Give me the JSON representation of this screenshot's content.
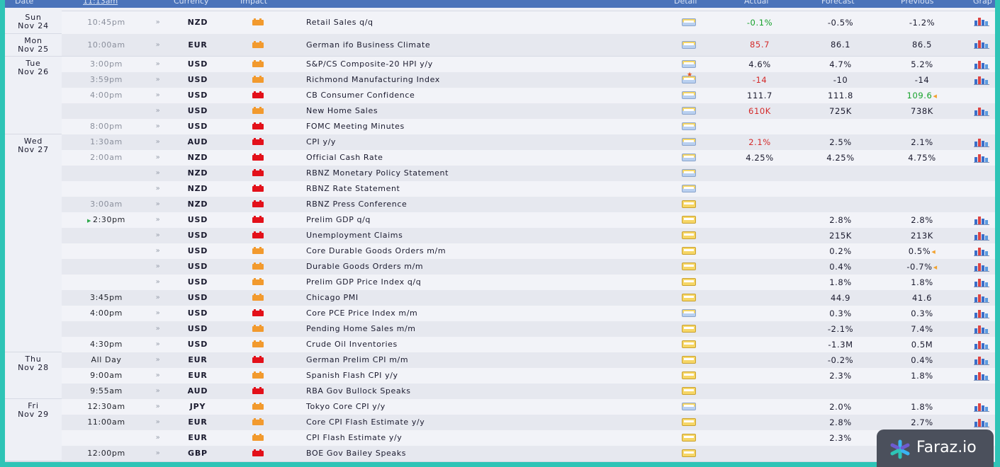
{
  "header": {
    "date": "Date",
    "time": "11:13am",
    "currency": "Currency",
    "impact": "Impact",
    "detail": "Detail",
    "actual": "Actual",
    "forecast": "Forecast",
    "previous": "Previous",
    "graph": "Grap"
  },
  "colors": {
    "high_impact": "#e3101a",
    "medium_impact": "#f29a2e",
    "negative": "#d42a2a",
    "positive": "#16a12b",
    "frame": "#2ec4b6"
  },
  "days": [
    {
      "label": "Sun",
      "date": "Nov 24"
    },
    {
      "label": "Mon",
      "date": "Nov 25"
    },
    {
      "label": "Tue",
      "date": "Nov 26"
    },
    {
      "label": "Wed",
      "date": "Nov 27"
    },
    {
      "label": "Thu",
      "date": "Nov 28"
    },
    {
      "label": "Fri",
      "date": "Nov 29"
    }
  ],
  "events": [
    {
      "time": "10:45pm",
      "currency": "NZD",
      "impact": "medium",
      "event": "Retail Sales q/q",
      "actual": "-0.1%",
      "actual_tone": "pos",
      "forecast": "-0.5%",
      "previous": "-1.2%",
      "graph": true,
      "detail": "blue"
    },
    {
      "time": "10:00am",
      "currency": "EUR",
      "impact": "medium",
      "event": "German ifo Business Climate",
      "actual": "85.7",
      "actual_tone": "neg",
      "forecast": "86.1",
      "previous": "86.5",
      "graph": true,
      "detail": "blue"
    },
    {
      "time": "3:00pm",
      "currency": "USD",
      "impact": "medium",
      "event": "S&P/CS Composite-20 HPI y/y",
      "actual": "4.6%",
      "actual_tone": "",
      "forecast": "4.7%",
      "previous": "5.2%",
      "graph": true,
      "detail": "blue"
    },
    {
      "time": "3:59pm",
      "currency": "USD",
      "impact": "medium",
      "event": "Richmond Manufacturing Index",
      "actual": "-14",
      "actual_tone": "neg",
      "forecast": "-10",
      "previous": "-14",
      "graph": true,
      "detail": "star"
    },
    {
      "time": "4:00pm",
      "currency": "USD",
      "impact": "high",
      "event": "CB Consumer Confidence",
      "actual": "111.7",
      "actual_tone": "",
      "forecast": "111.8",
      "previous": "109.6",
      "previous_tone": "pos",
      "previous_arrow": "orange",
      "graph": false,
      "detail": "blue"
    },
    {
      "time": "",
      "currency": "USD",
      "impact": "medium",
      "event": "New Home Sales",
      "actual": "610K",
      "actual_tone": "neg",
      "forecast": "725K",
      "previous": "738K",
      "graph": true,
      "detail": "blue"
    },
    {
      "time": "8:00pm",
      "currency": "USD",
      "impact": "high",
      "event": "FOMC Meeting Minutes",
      "actual": "",
      "forecast": "",
      "previous": "",
      "graph": false,
      "detail": "blue"
    },
    {
      "time": "1:30am",
      "currency": "AUD",
      "impact": "high",
      "event": "CPI y/y",
      "actual": "2.1%",
      "actual_tone": "neg",
      "forecast": "2.5%",
      "previous": "2.1%",
      "graph": true,
      "detail": "blue"
    },
    {
      "time": "2:00am",
      "currency": "NZD",
      "impact": "high",
      "event": "Official Cash Rate",
      "actual": "4.25%",
      "actual_tone": "",
      "forecast": "4.25%",
      "previous": "4.75%",
      "graph": true,
      "detail": "blue"
    },
    {
      "time": "",
      "currency": "NZD",
      "impact": "high",
      "event": "RBNZ Monetary Policy Statement",
      "actual": "",
      "forecast": "",
      "previous": "",
      "graph": false,
      "detail": "blue"
    },
    {
      "time": "",
      "currency": "NZD",
      "impact": "high",
      "event": "RBNZ Rate Statement",
      "actual": "",
      "forecast": "",
      "previous": "",
      "graph": false,
      "detail": "blue"
    },
    {
      "time": "3:00am",
      "currency": "NZD",
      "impact": "high",
      "event": "RBNZ Press Conference",
      "actual": "",
      "forecast": "",
      "previous": "",
      "graph": false,
      "detail": "yellow"
    },
    {
      "time": "2:30pm",
      "time_marker": "▶",
      "time_up": true,
      "currency": "USD",
      "impact": "high",
      "event": "Prelim GDP q/q",
      "actual": "",
      "forecast": "2.8%",
      "previous": "2.8%",
      "graph": true,
      "detail": "yellow"
    },
    {
      "time": "",
      "currency": "USD",
      "impact": "high",
      "event": "Unemployment Claims",
      "actual": "",
      "forecast": "215K",
      "previous": "213K",
      "graph": true,
      "detail": "yellow"
    },
    {
      "time": "",
      "currency": "USD",
      "impact": "medium",
      "event": "Core Durable Goods Orders m/m",
      "actual": "",
      "forecast": "0.2%",
      "previous": "0.5%",
      "previous_arrow": "orange",
      "graph": true,
      "detail": "yellow"
    },
    {
      "time": "",
      "currency": "USD",
      "impact": "medium",
      "event": "Durable Goods Orders m/m",
      "actual": "",
      "forecast": "0.4%",
      "previous": "-0.7%",
      "previous_arrow": "orange",
      "graph": true,
      "detail": "yellow"
    },
    {
      "time": "",
      "currency": "USD",
      "impact": "medium",
      "event": "Prelim GDP Price Index q/q",
      "actual": "",
      "forecast": "1.8%",
      "previous": "1.8%",
      "graph": true,
      "detail": "yellow"
    },
    {
      "time": "3:45pm",
      "time_up": true,
      "currency": "USD",
      "impact": "medium",
      "event": "Chicago PMI",
      "actual": "",
      "forecast": "44.9",
      "previous": "41.6",
      "graph": true,
      "detail": "yellow"
    },
    {
      "time": "4:00pm",
      "time_up": true,
      "currency": "USD",
      "impact": "high",
      "event": "Core PCE Price Index m/m",
      "actual": "",
      "forecast": "0.3%",
      "previous": "0.3%",
      "graph": true,
      "detail": "blue"
    },
    {
      "time": "",
      "currency": "USD",
      "impact": "medium",
      "event": "Pending Home Sales m/m",
      "actual": "",
      "forecast": "-2.1%",
      "previous": "7.4%",
      "graph": true,
      "detail": "yellow"
    },
    {
      "time": "4:30pm",
      "time_up": true,
      "currency": "USD",
      "impact": "medium",
      "event": "Crude Oil Inventories",
      "actual": "",
      "forecast": "-1.3M",
      "previous": "0.5M",
      "graph": true,
      "detail": "yellow"
    },
    {
      "time": "All Day",
      "time_up": true,
      "currency": "EUR",
      "impact": "high",
      "event": "German Prelim CPI m/m",
      "actual": "",
      "forecast": "-0.2%",
      "previous": "0.4%",
      "graph": true,
      "detail": "yellow"
    },
    {
      "time": "9:00am",
      "time_up": true,
      "currency": "EUR",
      "impact": "medium",
      "event": "Spanish Flash CPI y/y",
      "actual": "",
      "forecast": "2.3%",
      "previous": "1.8%",
      "graph": true,
      "detail": "yellow"
    },
    {
      "time": "9:55am",
      "time_up": true,
      "currency": "AUD",
      "impact": "high",
      "event": "RBA Gov Bullock Speaks",
      "actual": "",
      "forecast": "",
      "previous": "",
      "graph": false,
      "detail": "yellow"
    },
    {
      "time": "12:30am",
      "time_up": true,
      "currency": "JPY",
      "impact": "medium",
      "event": "Tokyo Core CPI y/y",
      "actual": "",
      "forecast": "2.0%",
      "previous": "1.8%",
      "graph": true,
      "detail": "blue"
    },
    {
      "time": "11:00am",
      "time_up": true,
      "currency": "EUR",
      "impact": "medium",
      "event": "Core CPI Flash Estimate y/y",
      "actual": "",
      "forecast": "2.8%",
      "previous": "2.7%",
      "graph": true,
      "detail": "yellow"
    },
    {
      "time": "",
      "currency": "EUR",
      "impact": "medium",
      "event": "CPI Flash Estimate y/y",
      "actual": "",
      "forecast": "2.3%",
      "previous": "",
      "graph": false,
      "detail": "yellow"
    },
    {
      "time": "12:00pm",
      "time_up": true,
      "currency": "GBP",
      "impact": "high",
      "event": "BOE Gov Bailey Speaks",
      "actual": "",
      "forecast": "",
      "previous": "",
      "graph": false,
      "detail": "yellow"
    }
  ],
  "badge": {
    "text": "Faraz.io",
    "icon": "faraz-logo-icon"
  }
}
